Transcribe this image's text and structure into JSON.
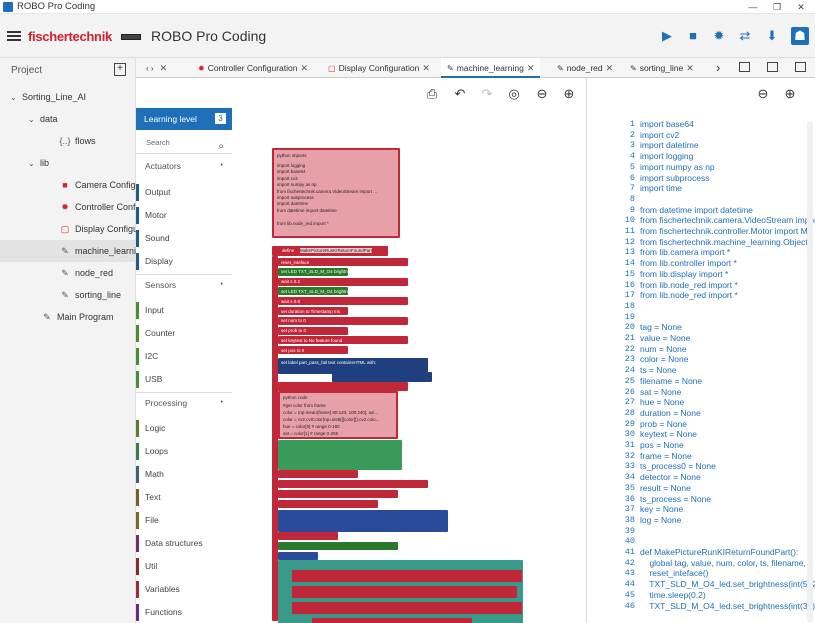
{
  "window": {
    "title": "ROBO Pro Coding",
    "controls": [
      "—",
      "❐",
      "✕"
    ]
  },
  "appbar": {
    "brand": "fischertechnik",
    "title": "ROBO Pro Coding"
  },
  "sidebar": {
    "header": "Project",
    "items": [
      {
        "label": "Sorting_Line_AI",
        "level": 0,
        "arrow": "⌄",
        "icon": ""
      },
      {
        "label": "data",
        "level": 1,
        "arrow": "⌄",
        "icon": ""
      },
      {
        "label": "flows",
        "level": 2,
        "arrow": "",
        "icon": "{..}"
      },
      {
        "label": "lib",
        "level": 1,
        "arrow": "⌄",
        "icon": ""
      },
      {
        "label": "Camera Configuratio",
        "level": 2,
        "arrow": "",
        "icon": "camera-icon"
      },
      {
        "label": "Controller Configura",
        "level": 2,
        "arrow": "",
        "icon": "gear-icon"
      },
      {
        "label": "Display Configuratio",
        "level": 2,
        "arrow": "",
        "icon": "display-icon"
      },
      {
        "label": "machine_learning",
        "level": 2,
        "arrow": "",
        "icon": "module-icon",
        "active": true
      },
      {
        "label": "node_red",
        "level": 2,
        "arrow": "",
        "icon": "module-icon"
      },
      {
        "label": "sorting_line",
        "level": 2,
        "arrow": "",
        "icon": "module-icon"
      },
      {
        "label": "Main Program",
        "level": 1,
        "arrow": "",
        "icon": "module-icon"
      }
    ]
  },
  "tabs": [
    {
      "label": "",
      "icon": "‹ ›",
      "close": "✕"
    },
    {
      "label": "Controller Configuration",
      "icon": "gear-icon",
      "close": "✕"
    },
    {
      "label": "Display Configuration",
      "icon": "display-icon",
      "close": "✕"
    },
    {
      "label": "machine_learning",
      "icon": "module-icon",
      "close": "✕",
      "active": true
    },
    {
      "label": "node_red",
      "icon": "module-icon",
      "close": "✕"
    },
    {
      "label": "sorting_line",
      "icon": "module-icon",
      "close": "✕"
    }
  ],
  "toolbox": {
    "learning_level_label": "Learning level",
    "learning_level": "3",
    "search_placeholder": "Search",
    "categories": [
      {
        "label": "Actuators",
        "header": true,
        "color": ""
      },
      {
        "label": "Output",
        "color": "#1e5c8c"
      },
      {
        "label": "Motor",
        "color": "#1e5c8c"
      },
      {
        "label": "Sound",
        "color": "#1e5c8c"
      },
      {
        "label": "Display",
        "color": "#1e5c8c"
      },
      {
        "label": "Sensors",
        "header": true,
        "color": ""
      },
      {
        "label": "Input",
        "color": "#4a8f2a"
      },
      {
        "label": "Counter",
        "color": "#4a8f2a"
      },
      {
        "label": "I2C",
        "color": "#4a8f2a"
      },
      {
        "label": "USB",
        "color": "#4a8f2a"
      },
      {
        "label": "Processing",
        "header": true,
        "color": ""
      },
      {
        "label": "Logic",
        "color": "#5b7f1f"
      },
      {
        "label": "Loops",
        "color": "#3f7a4a"
      },
      {
        "label": "Math",
        "color": "#3f5f7f"
      },
      {
        "label": "Text",
        "color": "#7a5f2a"
      },
      {
        "label": "File",
        "color": "#6f6f2a"
      },
      {
        "label": "Data structures",
        "color": "#7a2a6f"
      },
      {
        "label": "Util",
        "color": "#8a2a2a"
      },
      {
        "label": "Variables",
        "color": "#a02a3a"
      },
      {
        "label": "Functions",
        "color": "#6a2a8a"
      }
    ]
  },
  "blocks": {
    "python_imports_title": "python imports",
    "python_imports_lines": [
      "import logging",
      "import base64",
      "import cv2",
      "import numpy as np",
      "from fischertechnik.camera.VideoStream import ...",
      "import subprocess",
      "import datetime",
      "from datetime import datetime",
      "",
      "from lib.node_red import *"
    ],
    "define_label": "define",
    "define_name": "MakePictureRunKIReturnFoundPart",
    "rows": [
      {
        "t": "reset_inteface",
        "c": "#c0283a"
      },
      {
        "t": "set LED  TXT_SLD_M_O4  brightness  512",
        "c": "#2a7a2a"
      },
      {
        "t": "wait  s  0.2",
        "c": "#c0283a"
      },
      {
        "t": "set LED  TXT_SLD_M_O4  brightness  30",
        "c": "#2a7a2a"
      },
      {
        "t": "wait  s  0.8",
        "c": "#c0283a"
      },
      {
        "t": "set  duration  to  Timestamp  ms",
        "c": "#c0283a"
      },
      {
        "t": "set  num  to  0",
        "c": "#c0283a"
      },
      {
        "t": "set  prob  to  0",
        "c": "#c0283a"
      },
      {
        "t": "set  keytext  to  No feature found",
        "c": "#c0283a"
      },
      {
        "t": "set  pos  to  0",
        "c": "#c0283a"
      }
    ],
    "python_code_title": "python code",
    "python_code_lines": [
      "#get color from frame",
      "color = (np.mean(frame[ 80:120, 100:240], axi...",
      "color = cv2.cvtColor(np.uint8([[color]]),cv2.colo...",
      "hue = color[0] # range 0-180",
      "sat = color[1] # range 0-255"
    ]
  },
  "code": {
    "start_line": 1,
    "lines": [
      "import base64",
      "import cv2",
      "import datetime",
      "import logging",
      "import numpy as np",
      "import subprocess",
      "import time",
      "",
      "from datetime import datetime",
      "from fischertechnik.camera.VideoStream import",
      "from fischertechnik.controller.Motor import M",
      "from fischertechnik.machine_learning.Object",
      "from lib.camera import *",
      "from lib.controller import *",
      "from lib.display import *",
      "from lib.node_red import *",
      "from lib.node_red import *",
      "",
      "",
      "tag = None",
      "value = None",
      "num = None",
      "color = None",
      "ts = None",
      "filename = None",
      "sat = None",
      "hue = None",
      "duration = None",
      "prob = None",
      "keytext = None",
      "pos = None",
      "frame = None",
      "ts_process0 = None",
      "detector = None",
      "result = None",
      "ts_process = None",
      "key = None",
      "log = None",
      "",
      "",
      "def MakePictureRunKIReturnFoundPart():",
      "    global tag, value, num, color, ts, filename, s",
      "    reset_inteface()",
      "    TXT_SLD_M_O4_led.set_brightness(int(512",
      "    time.sleep(0.2)",
      "    TXT_SLD_M_O4_led.set_brightness(int(30)"
    ]
  }
}
